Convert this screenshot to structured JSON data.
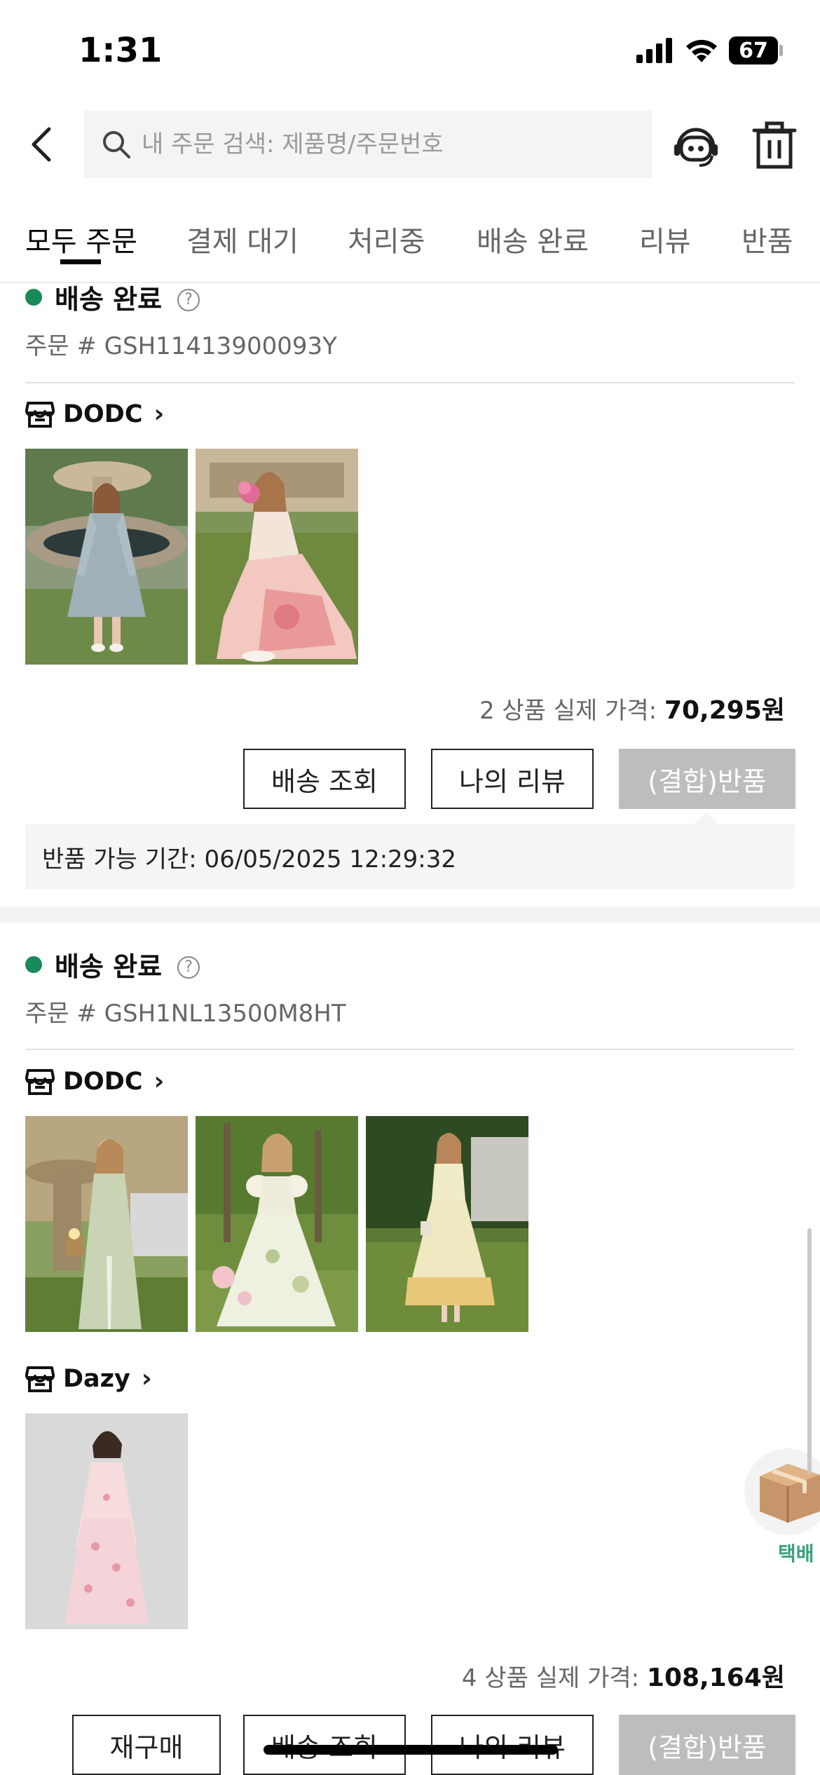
{
  "status_bar": {
    "time": "1:31",
    "battery": "67"
  },
  "header": {
    "search_placeholder": "내 주문 검색: 제품명/주문번호"
  },
  "tabs": [
    {
      "label": "모두 주문",
      "active": true
    },
    {
      "label": "결제 대기"
    },
    {
      "label": "처리중"
    },
    {
      "label": "배송 완료"
    },
    {
      "label": "리뷰"
    },
    {
      "label": "반품"
    }
  ],
  "orders": [
    {
      "status": "배송 완료",
      "order_no": "주문 #  GSH11413900093Y",
      "stores": [
        {
          "name": "DODC",
          "thumb_count": 2
        }
      ],
      "price_label": "2 상품 실제 가격: ",
      "price": "70,295원",
      "buttons": [
        "배송 조회",
        "나의 리뷰",
        "(결합)반품"
      ],
      "return_period": "반품 가능 기간: 06/05/2025 12:29:32"
    },
    {
      "status": "배송 완료",
      "order_no": "주문 #  GSH1NL13500M8HT",
      "stores": [
        {
          "name": "DODC",
          "thumb_count": 3
        },
        {
          "name": "Dazy",
          "thumb_count": 1
        }
      ],
      "price_label": "4 상품 실제 가격: ",
      "price": "108,164원",
      "buttons": [
        "재구매",
        "배송 조회",
        "나의 리뷰",
        "(결합)반품"
      ]
    }
  ],
  "float": {
    "label": "택배"
  },
  "colors": {
    "status_green": "#1a8a5a",
    "disabled_btn": "#bdbdbd",
    "float_label": "#3aa17a"
  }
}
